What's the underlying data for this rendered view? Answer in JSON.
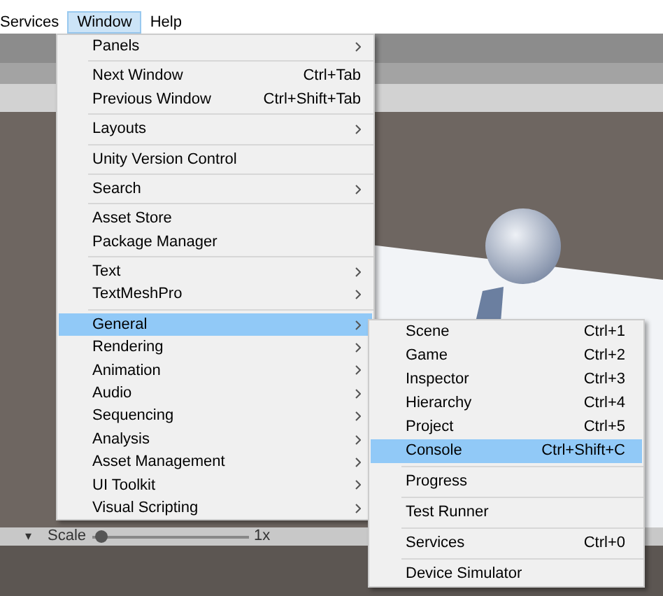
{
  "menubar": [
    {
      "label": "Services",
      "selected": false
    },
    {
      "label": "Window",
      "selected": true
    },
    {
      "label": "Help",
      "selected": false
    }
  ],
  "window_menu": {
    "groups": [
      [
        {
          "label": "Panels",
          "submenu": true,
          "selected": false
        }
      ],
      [
        {
          "label": "Next Window",
          "shortcut": "Ctrl+Tab",
          "submenu": false,
          "selected": false
        },
        {
          "label": "Previous Window",
          "shortcut": "Ctrl+Shift+Tab",
          "submenu": false,
          "selected": false
        }
      ],
      [
        {
          "label": "Layouts",
          "submenu": true,
          "selected": false
        }
      ],
      [
        {
          "label": "Unity Version Control",
          "submenu": false,
          "selected": false
        }
      ],
      [
        {
          "label": "Search",
          "submenu": true,
          "selected": false
        }
      ],
      [
        {
          "label": "Asset Store",
          "submenu": false,
          "selected": false
        },
        {
          "label": "Package Manager",
          "submenu": false,
          "selected": false
        }
      ],
      [
        {
          "label": "Text",
          "submenu": true,
          "selected": false
        },
        {
          "label": "TextMeshPro",
          "submenu": true,
          "selected": false
        }
      ],
      [
        {
          "label": "General",
          "submenu": true,
          "selected": true
        },
        {
          "label": "Rendering",
          "submenu": true,
          "selected": false
        },
        {
          "label": "Animation",
          "submenu": true,
          "selected": false
        },
        {
          "label": "Audio",
          "submenu": true,
          "selected": false
        },
        {
          "label": "Sequencing",
          "submenu": true,
          "selected": false
        },
        {
          "label": "Analysis",
          "submenu": true,
          "selected": false
        },
        {
          "label": "Asset Management",
          "submenu": true,
          "selected": false
        },
        {
          "label": "UI Toolkit",
          "submenu": true,
          "selected": false
        },
        {
          "label": "Visual Scripting",
          "submenu": true,
          "selected": false
        }
      ]
    ]
  },
  "general_submenu": {
    "groups": [
      [
        {
          "label": "Scene",
          "shortcut": "Ctrl+1",
          "selected": false
        },
        {
          "label": "Game",
          "shortcut": "Ctrl+2",
          "selected": false
        },
        {
          "label": "Inspector",
          "shortcut": "Ctrl+3",
          "selected": false
        },
        {
          "label": "Hierarchy",
          "shortcut": "Ctrl+4",
          "selected": false
        },
        {
          "label": "Project",
          "shortcut": "Ctrl+5",
          "selected": false
        },
        {
          "label": "Console",
          "shortcut": "Ctrl+Shift+C",
          "selected": true
        }
      ],
      [
        {
          "label": "Progress",
          "selected": false
        }
      ],
      [
        {
          "label": "Test Runner",
          "selected": false
        }
      ],
      [
        {
          "label": "Services",
          "shortcut": "Ctrl+0",
          "selected": false
        }
      ],
      [
        {
          "label": "Device Simulator",
          "selected": false
        }
      ]
    ]
  },
  "scene_toolbar": {
    "dropdown": "▾",
    "scale_label": "Scale",
    "scale": {
      "level": 0.02
    },
    "scale_value": "1x"
  }
}
